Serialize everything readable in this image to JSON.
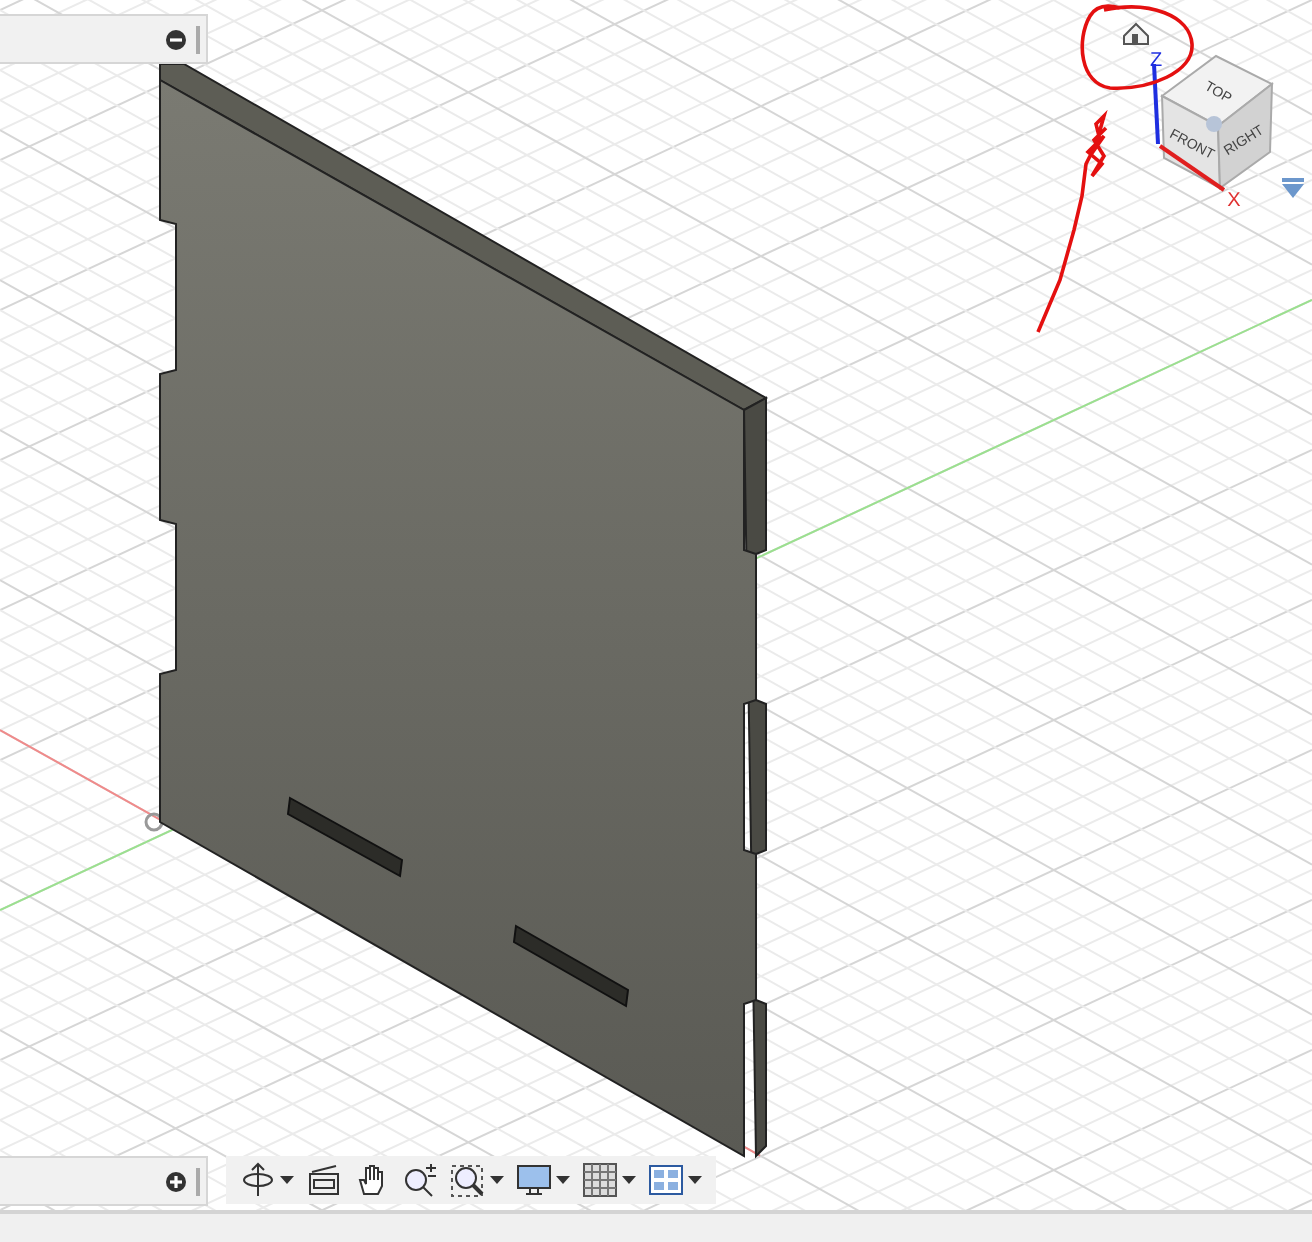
{
  "viewcube": {
    "top": "TOP",
    "front": "FRONT",
    "right": "RIGHT",
    "z_axis": "Z",
    "x_axis": "X"
  },
  "browser_panel": {
    "expanded": true
  },
  "comments_panel": {
    "expanded": false
  },
  "navigation_toolbar": [
    {
      "kind": "orbit",
      "menu": true
    },
    {
      "kind": "look",
      "menu": false
    },
    {
      "kind": "pan",
      "menu": false
    },
    {
      "kind": "zoom",
      "menu": false
    },
    {
      "kind": "fit",
      "menu": true
    },
    {
      "kind": "display",
      "menu": true
    },
    {
      "kind": "grid",
      "menu": true
    },
    {
      "kind": "viewports",
      "menu": true
    }
  ]
}
